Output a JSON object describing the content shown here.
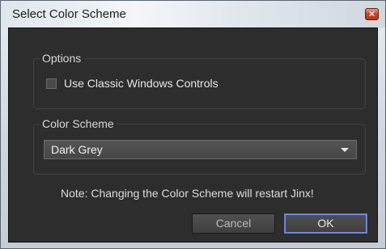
{
  "window": {
    "title": "Select Color Scheme",
    "close_glyph": "✕"
  },
  "options": {
    "group_label": "Options",
    "classic_controls": {
      "label": "Use Classic Windows Controls",
      "checked": false
    }
  },
  "color_scheme": {
    "group_label": "Color Scheme",
    "selected": "Dark Grey"
  },
  "note": "Note: Changing the Color Scheme will restart Jinx!",
  "buttons": {
    "cancel": "Cancel",
    "ok": "OK"
  }
}
